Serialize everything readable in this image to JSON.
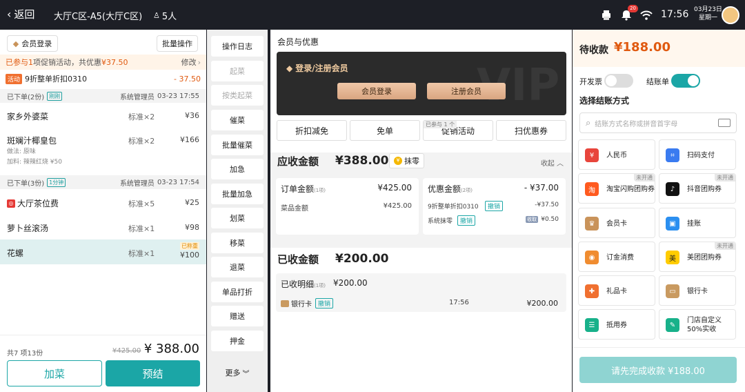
{
  "topbar": {
    "back": "返回",
    "table": "大厅C区-A5(大厅C区)",
    "people": "5人",
    "notif_count": "20",
    "time": "17:56",
    "date": "03月23日",
    "weekday": "星期一"
  },
  "left": {
    "member_login": "会员登录",
    "batch_op": "批量操作",
    "promo_line_pre": "已参与",
    "promo_line_num": "1",
    "promo_line_mid": "项促销活动，共优惠",
    "promo_line_amt": "¥37.50",
    "promo_edit": "修改",
    "activity_tag": "活动",
    "activity_name": "9折整单折扣0310",
    "activity_amt": "- 37.50",
    "section1": {
      "title": "已下单(2份)",
      "tag": "刚刚",
      "staff": "系统管理员",
      "time": "03-23 17:55"
    },
    "section2": {
      "title": "已下单(3份)",
      "tag": "1分钟",
      "staff": "系统管理员",
      "time": "03-23 17:54"
    },
    "items1": [
      {
        "name": "家乡外婆菜",
        "spec": "标准×2",
        "price": "¥36"
      },
      {
        "name": "斑斓汁椰皇包",
        "spec": "标准×2",
        "price": "¥166",
        "method_label": "做法:",
        "method": "原味",
        "addon_label": "加料:",
        "addon": "辣辣红烧 ¥50"
      }
    ],
    "items2": [
      {
        "name": "大厅茶位费",
        "spec": "标准×5",
        "price": "¥25"
      },
      {
        "name": "萝卜丝滚汤",
        "spec": "标准×1",
        "price": "¥98"
      },
      {
        "name": "花螺",
        "spec": "标准×1",
        "price": "¥100",
        "badge": "已称重"
      }
    ],
    "summary": "共7 项13份",
    "original_total": "¥425.00",
    "total": "¥ 388.00",
    "add_btn": "加菜",
    "pre_btn": "预结"
  },
  "ops": [
    "操作日志",
    "起菜",
    "按类起菜",
    "催菜",
    "批量催菜",
    "加急",
    "批量加急",
    "划菜",
    "移菜",
    "退菜",
    "单品打折",
    "赠送",
    "押金"
  ],
  "ops_more": "更多",
  "mid": {
    "header": "会员与优惠",
    "vip_title": "登录/注册会员",
    "vip_login": "会员登录",
    "vip_register": "注册会员",
    "tabs": [
      "折扣减免",
      "免单",
      "促销活动",
      "扫优惠券"
    ],
    "promo_joined": "已参与 1 个",
    "receivable_label": "应收金额",
    "receivable": "¥388.00",
    "round_btn": "抹零",
    "collapse": "收起",
    "order_label": "订单金额",
    "order_count": "(1项)",
    "order_amt": "¥425.00",
    "dish_label": "菜品金额",
    "dish_amt": "¥425.00",
    "discount_label": "优惠金额",
    "discount_count": "(2项)",
    "discount_amt": "- ¥37.00",
    "disc1_name": "9折整单折扣0310",
    "disc1_undo": "撤销",
    "disc1_amt": "-¥37.50",
    "disc2_name": "系统抹零",
    "disc2_undo": "撤销",
    "disc2_tag": "收取",
    "disc2_amt": "¥0.50",
    "received_label": "已收金额",
    "received": "¥200.00",
    "received_detail": "已收明细",
    "received_count": "(1项)",
    "received_detail_amt": "¥200.00",
    "pay_method": "银行卡",
    "pay_undo": "撤销",
    "pay_time": "17:56",
    "pay_amt": "¥200.00"
  },
  "right": {
    "pending_label": "待收款",
    "pending": "¥188.00",
    "invoice": "开发票",
    "bill": "结账单",
    "choose": "选择结账方式",
    "search_placeholder": "结账方式名称或拼音首字母",
    "methods": [
      {
        "name": "人民币",
        "icon": "cash-icon",
        "color": "#e8453c"
      },
      {
        "name": "扫码支付",
        "icon": "scan-icon",
        "color": "#3a7bf0"
      },
      {
        "name": "淘宝闪购团购券",
        "icon": "taobao-icon",
        "color": "#ff5a1f",
        "na": "未开通"
      },
      {
        "name": "抖音团购券",
        "icon": "douyin-icon",
        "color": "#111111",
        "na": "未开通"
      },
      {
        "name": "会员卡",
        "icon": "member-card-icon",
        "color": "#c9935a"
      },
      {
        "name": "挂账",
        "icon": "credit-icon",
        "color": "#2b8ff0"
      },
      {
        "name": "订金消费",
        "icon": "deposit-icon",
        "color": "#f08c30"
      },
      {
        "name": "美团团购券",
        "icon": "meituan-icon",
        "color": "#ffcc00",
        "na": "未开通"
      },
      {
        "name": "礼品卡",
        "icon": "gift-card-icon",
        "color": "#f07030"
      },
      {
        "name": "银行卡",
        "icon": "bank-card-icon",
        "color": "#c99a60"
      },
      {
        "name": "抵用券",
        "icon": "voucher-icon",
        "color": "#18b18a"
      },
      {
        "name": "门店自定义50%实收",
        "icon": "custom-icon",
        "color": "#18b18a"
      }
    ],
    "submit": "请先完成收款 ¥188.00"
  },
  "colors": {
    "accent": "#1ba6a6",
    "price": "#e05a10"
  }
}
